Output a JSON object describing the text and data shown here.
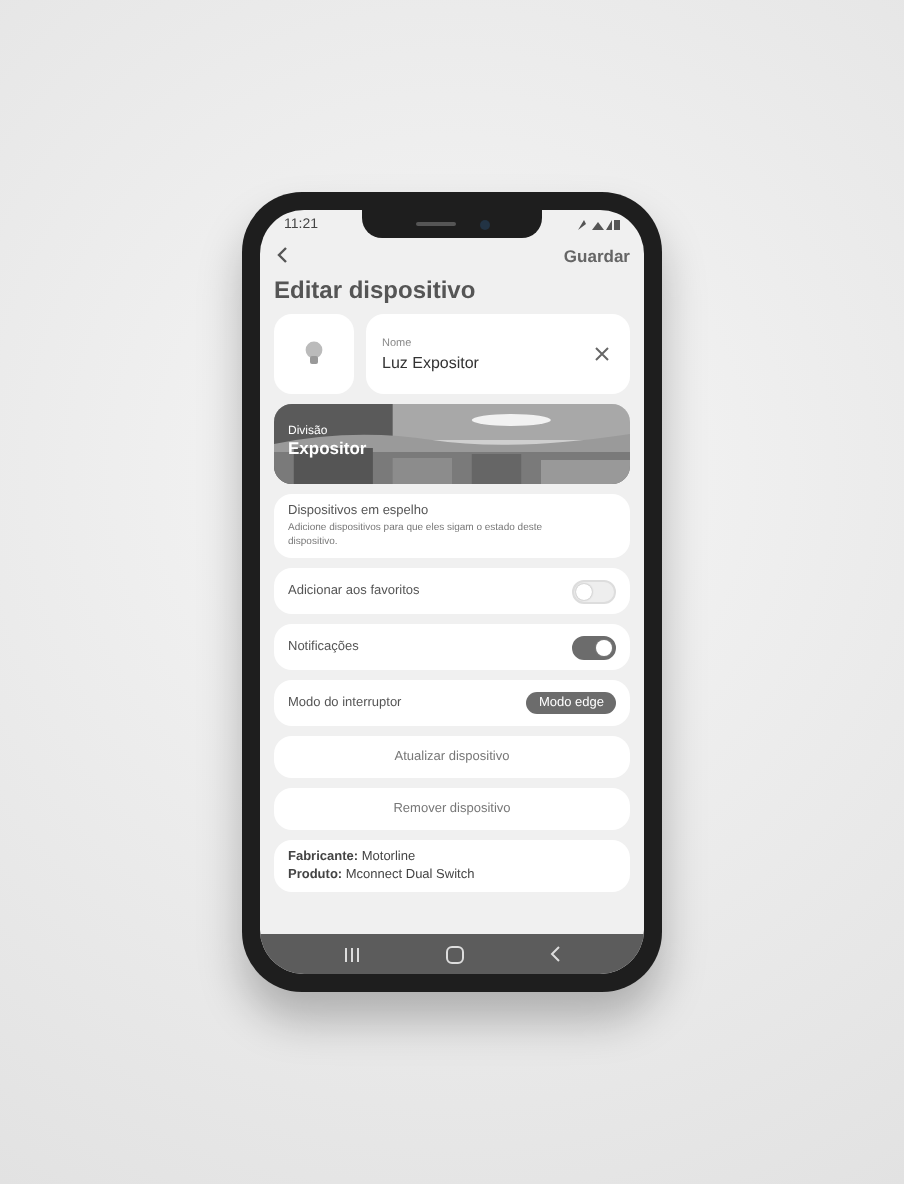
{
  "status_bar": {
    "time": "11:21"
  },
  "header": {
    "action": "Guardar"
  },
  "title": "Editar dispositivo",
  "name_field": {
    "label": "Nome",
    "value": "Luz Expositor"
  },
  "division": {
    "label": "Divisão",
    "value": "Expositor"
  },
  "mirror": {
    "title": "Dispositivos em espelho",
    "description": "Adicione dispositivos para que eles sigam o estado deste dispositivo."
  },
  "settings": [
    {
      "kind": "toggle",
      "label": "Adicionar aos favoritos",
      "on": false
    },
    {
      "kind": "toggle",
      "label": "Notificações",
      "on": true
    },
    {
      "kind": "choice",
      "label": "Modo do interruptor",
      "value": "Modo edge"
    }
  ],
  "actions": [
    "Atualizar dispositivo",
    "Remover dispositivo"
  ],
  "info": [
    "**Fabricante:** Motorline",
    "**Produto:** Mconnect Dual Switch"
  ]
}
